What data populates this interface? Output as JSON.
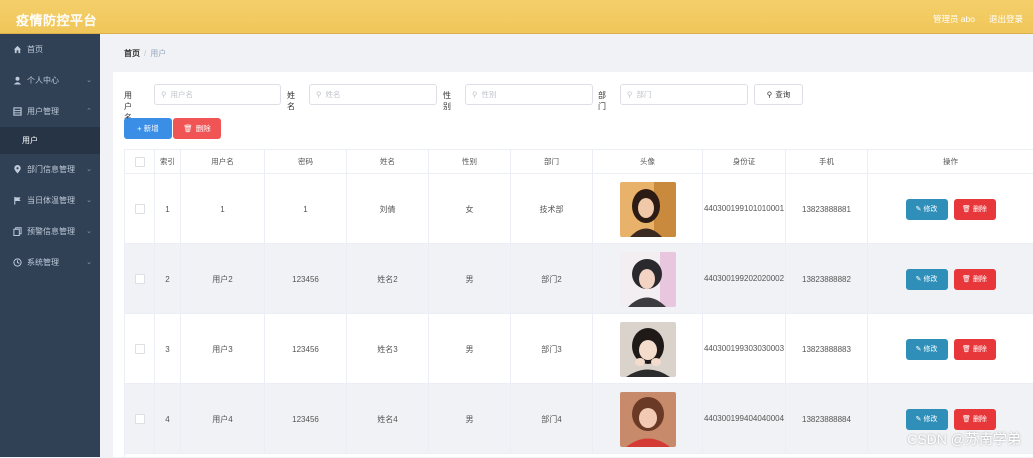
{
  "header": {
    "title": "疫情防控平台",
    "admin": "管理员 abo",
    "logout": "退出登录"
  },
  "sidebar": {
    "items": [
      {
        "label": "首页",
        "icon": "home-icon",
        "has_sub": false
      },
      {
        "label": "个人中心",
        "icon": "user-icon",
        "has_sub": true
      },
      {
        "label": "用户管理",
        "icon": "table-icon",
        "has_sub": true
      },
      {
        "label": "部门信息管理",
        "icon": "location-icon",
        "has_sub": true
      },
      {
        "label": "当日体温管理",
        "icon": "flag-icon",
        "has_sub": true
      },
      {
        "label": "预警信息管理",
        "icon": "copy-icon",
        "has_sub": true
      },
      {
        "label": "系统管理",
        "icon": "clock-icon",
        "has_sub": true
      }
    ],
    "active_sub": "用户"
  },
  "breadcrumb": {
    "home": "首页",
    "sep": "/",
    "current": "用户"
  },
  "filters": {
    "username_label": "用户名",
    "username_placeholder": "用户名",
    "name_label": "姓名",
    "name_placeholder": "姓名",
    "gender_label": "性别",
    "gender_placeholder": "性别",
    "dept_label": "部门",
    "dept_placeholder": "部门",
    "query": "查询"
  },
  "actions": {
    "add": "+ 新增",
    "delete": "删除"
  },
  "table": {
    "columns": [
      "索引",
      "用户名",
      "密码",
      "姓名",
      "性别",
      "部门",
      "头像",
      "身份证",
      "手机",
      "操作"
    ],
    "rows": [
      {
        "index": "1",
        "username": "1",
        "password": "1",
        "name": "刘倩",
        "gender": "女",
        "dept": "技术部",
        "id_card": "440300199101010001",
        "phone": "13823888881"
      },
      {
        "index": "2",
        "username": "用户2",
        "password": "123456",
        "name": "姓名2",
        "gender": "男",
        "dept": "部门2",
        "id_card": "440300199202020002",
        "phone": "13823888882"
      },
      {
        "index": "3",
        "username": "用户3",
        "password": "123456",
        "name": "姓名3",
        "gender": "男",
        "dept": "部门3",
        "id_card": "440300199303030003",
        "phone": "13823888883"
      },
      {
        "index": "4",
        "username": "用户4",
        "password": "123456",
        "name": "姓名4",
        "gender": "男",
        "dept": "部门4",
        "id_card": "440300199404040004",
        "phone": "13823888884"
      }
    ],
    "edit_label": "修改",
    "delete_label": "删除"
  },
  "watermark": "CSDN @苏南学弟",
  "colors": {
    "topbar": "#f0c65a",
    "sidebar": "#304156",
    "primary": "#3a8ee6",
    "danger": "#f05454",
    "edit": "#2f8fb9"
  }
}
